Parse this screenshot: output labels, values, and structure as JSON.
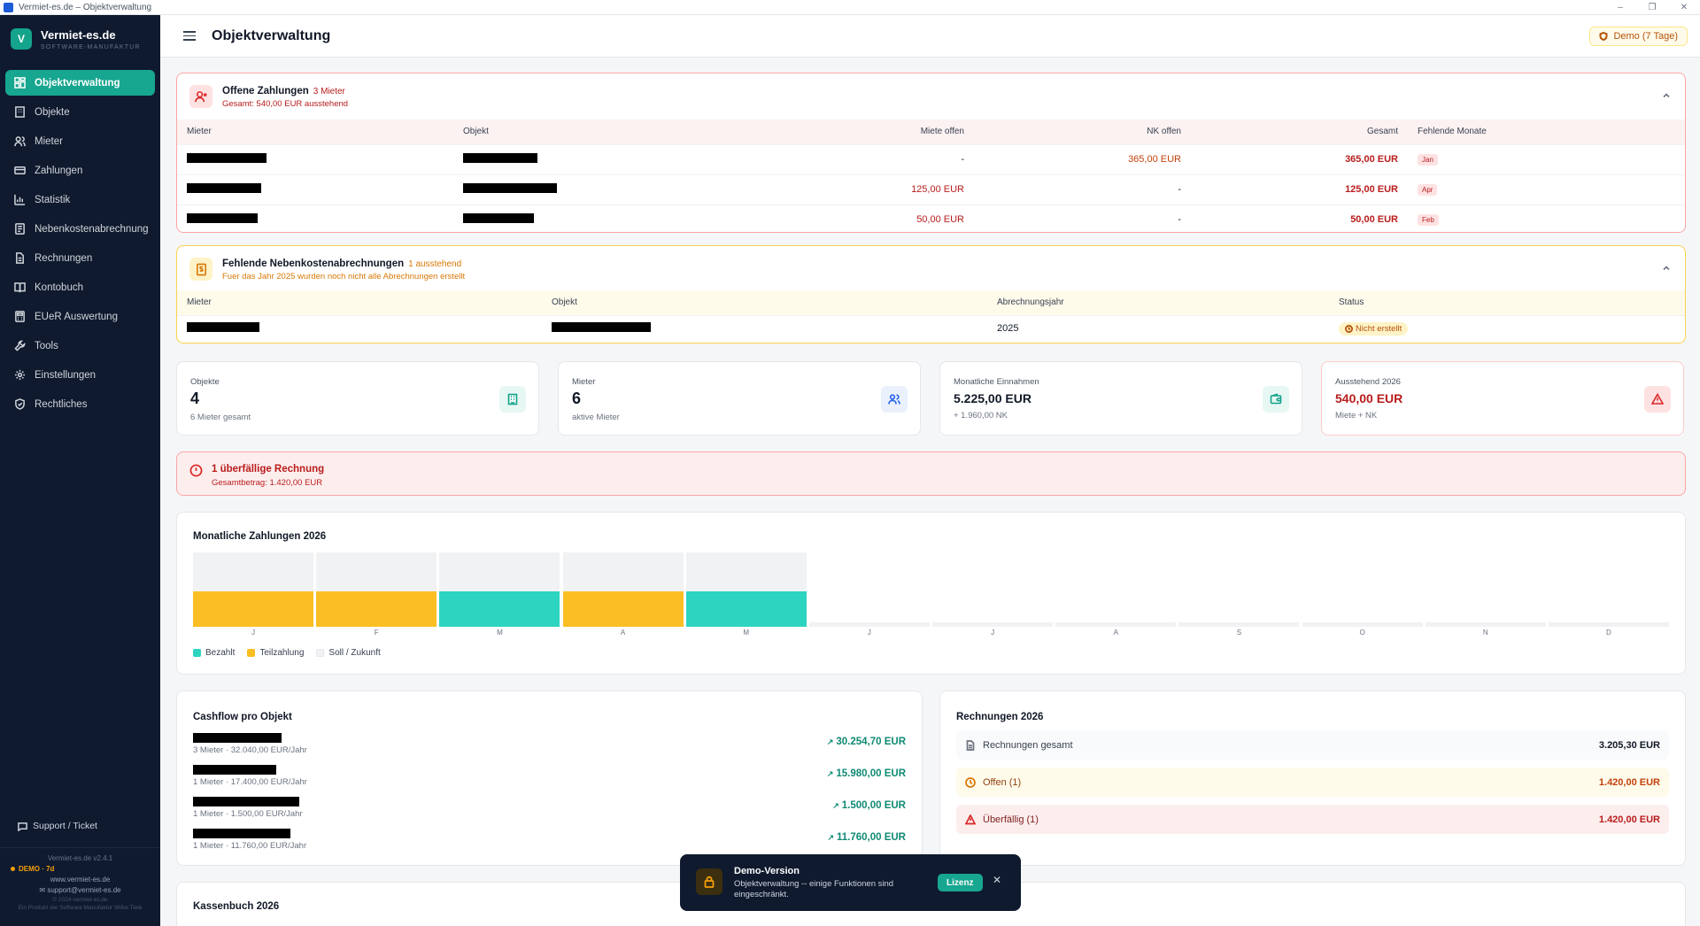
{
  "window": {
    "title": "Vermiet-es.de – Objektverwaltung",
    "controls": [
      "–",
      "❐",
      "✕"
    ]
  },
  "brand": {
    "logo_letter": "V",
    "name": "Vermiet-es.de",
    "sub": "SOFTWARE-MANUFAKTUR"
  },
  "nav": [
    {
      "label": "Objektverwaltung",
      "icon": "dashboard-icon",
      "active": true
    },
    {
      "label": "Objekte",
      "icon": "building-icon"
    },
    {
      "label": "Mieter",
      "icon": "users-icon"
    },
    {
      "label": "Zahlungen",
      "icon": "credit-card-icon"
    },
    {
      "label": "Statistik",
      "icon": "bar-chart-icon"
    },
    {
      "label": "Nebenkostenabrechnung",
      "icon": "receipt-icon"
    },
    {
      "label": "Rechnungen",
      "icon": "document-icon"
    },
    {
      "label": "Kontobuch",
      "icon": "book-icon"
    },
    {
      "label": "EUeR Auswertung",
      "icon": "calculator-icon"
    },
    {
      "label": "Tools",
      "icon": "wrench-icon"
    },
    {
      "label": "Einstellungen",
      "icon": "gear-icon"
    },
    {
      "label": "Rechtliches",
      "icon": "shield-icon"
    }
  ],
  "sidebar_footer": {
    "support": "Support / Ticket",
    "version": "Vermiet-es.de v2.4.1",
    "demo": "DEMO · 7d",
    "website": "www.vermiet-es.de",
    "email": "support@vermiet-es.de",
    "copyright": "© 2024 vermiet-es.de",
    "product_line": "Ein Produkt der Software Manufaktur Wilke Tiele"
  },
  "header": {
    "title": "Objektverwaltung",
    "demo_badge": "Demo (7 Tage)"
  },
  "open_payments": {
    "title": "Offene Zahlungen",
    "count": "3 Mieter",
    "subtitle": "Gesamt: 540,00 EUR ausstehend",
    "columns": [
      "Mieter",
      "Objekt",
      "Miete offen",
      "NK offen",
      "Gesamt",
      "Fehlende Monate"
    ],
    "rows": [
      {
        "miete": "-",
        "nk": "365,00 EUR",
        "gesamt": "365,00 EUR",
        "monat": "Jan"
      },
      {
        "miete": "125,00 EUR",
        "nk": "-",
        "gesamt": "125,00 EUR",
        "monat": "Apr"
      },
      {
        "miete": "50,00 EUR",
        "nk": "-",
        "gesamt": "50,00 EUR",
        "monat": "Feb"
      }
    ]
  },
  "missing_nk": {
    "title": "Fehlende Nebenkostenabrechnungen",
    "count": "1 ausstehend",
    "subtitle": "Fuer das Jahr 2025 wurden noch nicht alle Abrechnungen erstellt",
    "columns": [
      "Mieter",
      "Objekt",
      "Abrechnungsjahr",
      "Status"
    ],
    "rows": [
      {
        "jahr": "2025",
        "status": "Nicht erstellt"
      }
    ]
  },
  "stats": [
    {
      "label": "Objekte",
      "value": "4",
      "hint": "6 Mieter gesamt",
      "icon": "building-icon"
    },
    {
      "label": "Mieter",
      "value": "6",
      "hint": "aktive Mieter",
      "icon": "users-icon"
    },
    {
      "label": "Monatliche Einnahmen",
      "value": "5.225,00 EUR",
      "hint": "+ 1.960,00 NK",
      "icon": "wallet-icon"
    },
    {
      "label": "Ausstehend 2026",
      "value": "540,00 EUR",
      "hint": "Miete + NK",
      "icon": "warning-icon"
    }
  ],
  "overdue_alert": {
    "title": "1 überfällige Rechnung",
    "subtitle": "Gesamtbetrag: 1.420,00 EUR"
  },
  "chart_data": {
    "type": "bar",
    "title": "Monatliche Zahlungen 2026",
    "categories": [
      "J",
      "F",
      "M",
      "A",
      "M",
      "J",
      "J",
      "A",
      "S",
      "O",
      "N",
      "D"
    ],
    "status": [
      "Teilzahlung",
      "Teilzahlung",
      "Bezahlt",
      "Teilzahlung",
      "Bezahlt",
      "Soll / Zukunft",
      "Soll / Zukunft",
      "Soll / Zukunft",
      "Soll / Zukunft",
      "Soll / Zukunft",
      "Soll / Zukunft",
      "Soll / Zukunft"
    ],
    "paid_fraction": [
      0.48,
      0.48,
      0.48,
      0.48,
      0.48,
      0,
      0,
      0,
      0,
      0,
      0,
      0
    ],
    "legend": [
      {
        "name": "Bezahlt",
        "color": "#2dd4bf"
      },
      {
        "name": "Teilzahlung",
        "color": "#fbbf24"
      },
      {
        "name": "Soll / Zukunft",
        "color": "#f1f2f4"
      }
    ],
    "legend_position": "bottom-left",
    "colors": {
      "Bezahlt": "#2dd4bf",
      "Teilzahlung": "#fbbf24",
      "Soll / Zukunft": "#f1f2f4"
    }
  },
  "cashflow": {
    "title": "Cashflow pro Objekt",
    "rows": [
      {
        "sub": "3 Mieter · 32.040,00 EUR/Jahr",
        "value": "30.254,70 EUR"
      },
      {
        "sub": "1 Mieter · 17.400,00 EUR/Jahr",
        "value": "15.980,00 EUR"
      },
      {
        "sub": "1 Mieter · 1.500,00 EUR/Jahr",
        "value": "1.500,00 EUR"
      },
      {
        "sub": "1 Mieter · 11.760,00 EUR/Jahr",
        "value": "11.760,00 EUR"
      }
    ]
  },
  "invoices": {
    "title": "Rechnungen 2026",
    "total_label": "Rechnungen gesamt",
    "total_value": "3.205,30 EUR",
    "open_label": "Offen (1)",
    "open_value": "1.420,00 EUR",
    "overdue_label": "Überfällig (1)",
    "overdue_value": "1.420,00 EUR"
  },
  "kassenbuch": {
    "title": "Kassenbuch 2026"
  },
  "toast": {
    "title": "Demo-Version",
    "text": "Objektverwaltung -- einige Funktionen sind eingeschränkt.",
    "button": "Lizenz",
    "close": "✕"
  }
}
